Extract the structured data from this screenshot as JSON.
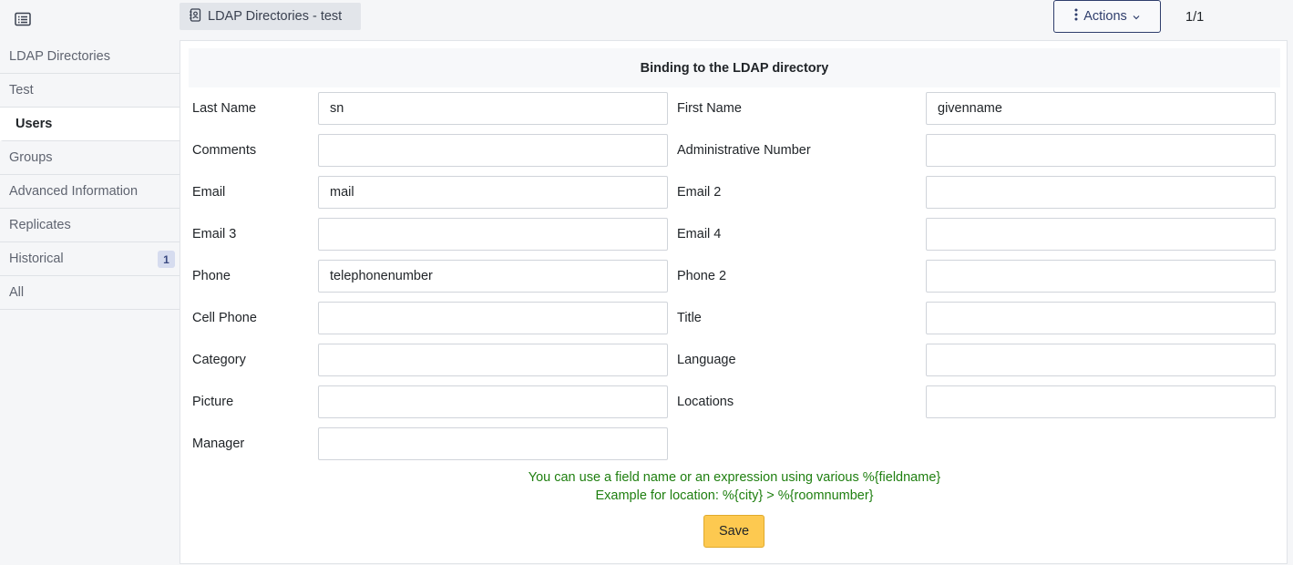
{
  "header": {
    "tab_title": "LDAP Directories - test",
    "actions_label": "Actions",
    "pager": "1/1"
  },
  "sidebar": {
    "items": [
      {
        "label": "LDAP Directories"
      },
      {
        "label": "Test"
      },
      {
        "label": "Users"
      },
      {
        "label": "Groups"
      },
      {
        "label": "Advanced Information"
      },
      {
        "label": "Replicates"
      },
      {
        "label": "Historical",
        "badge": "1"
      },
      {
        "label": "All"
      }
    ],
    "active": "Users"
  },
  "form": {
    "title": "Binding to the LDAP directory",
    "fields": {
      "last_name": {
        "label": "Last Name",
        "value": "sn"
      },
      "first_name": {
        "label": "First Name",
        "value": "givenname"
      },
      "comments": {
        "label": "Comments",
        "value": ""
      },
      "admin_number": {
        "label": "Administrative Number",
        "value": ""
      },
      "email": {
        "label": "Email",
        "value": "mail"
      },
      "email2": {
        "label": "Email 2",
        "value": ""
      },
      "email3": {
        "label": "Email 3",
        "value": ""
      },
      "email4": {
        "label": "Email 4",
        "value": ""
      },
      "phone": {
        "label": "Phone",
        "value": "telephonenumber"
      },
      "phone2": {
        "label": "Phone 2",
        "value": ""
      },
      "cell_phone": {
        "label": "Cell Phone",
        "value": ""
      },
      "title": {
        "label": "Title",
        "value": ""
      },
      "category": {
        "label": "Category",
        "value": ""
      },
      "language": {
        "label": "Language",
        "value": ""
      },
      "picture": {
        "label": "Picture",
        "value": ""
      },
      "locations": {
        "label": "Locations",
        "value": ""
      },
      "manager": {
        "label": "Manager",
        "value": ""
      }
    },
    "hint_line1": "You can use a field name or an expression using various %{fieldname}",
    "hint_line2": "Example for location: %{city} > %{roomnumber}",
    "save_label": "Save"
  },
  "icons": {
    "menu": "list-icon",
    "tab": "address-book-icon",
    "actions": "vertical-dots-icon",
    "actions_caret": "chevron-down-icon"
  },
  "colors": {
    "accent": "#2f3e6c",
    "save_button": "#fdc950",
    "hint_text": "#1f7f10",
    "badge_bg": "#d6dcef"
  }
}
